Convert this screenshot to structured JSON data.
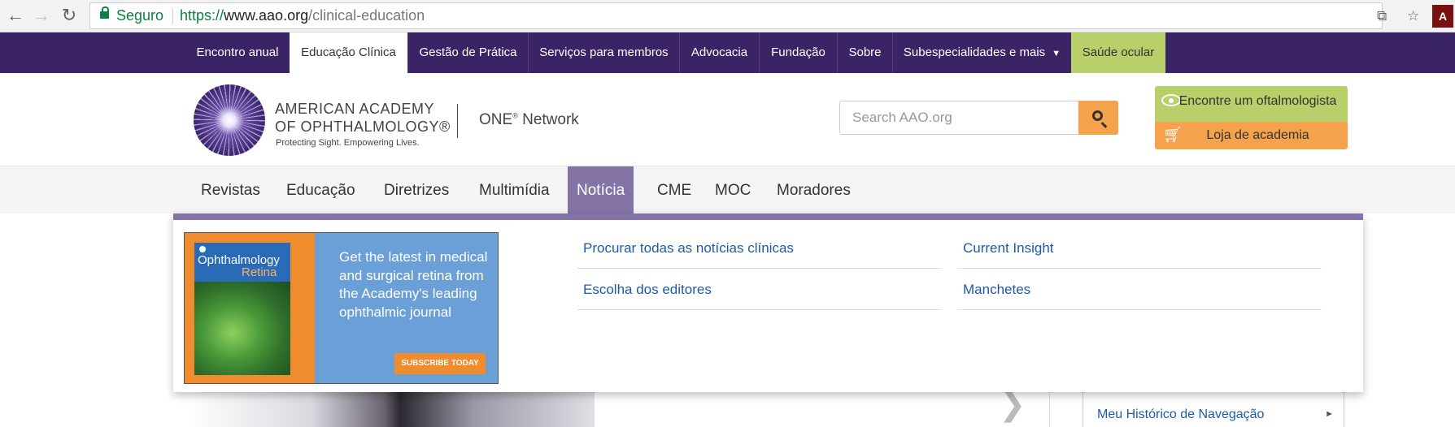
{
  "browser": {
    "secure_label": "Seguro",
    "url_scheme": "https://",
    "url_host": "www.aao.org",
    "url_path": "/clinical-education",
    "pdf_badge": "A"
  },
  "topbar": {
    "items": [
      "Encontro anual",
      "Educação Clínica",
      "Gestão de Prática",
      "Serviços para membros",
      "Advocacia",
      "Fundação",
      "Sobre",
      "Subespecialidades e mais",
      "Saúde ocular"
    ],
    "dropdown_arrow": "▼"
  },
  "logo": {
    "line1": "AMERICAN ACADEMY",
    "line2": "OF OPHTHALMOLOGY®",
    "tagline": "Protecting Sight. Empowering Lives.",
    "network_name": "ONE",
    "network_reg": "®",
    "network_suffix": " Network"
  },
  "search": {
    "placeholder": "Search AAO.org"
  },
  "cta": {
    "find": "Encontre um oftalmologista",
    "store": "Loja de academia"
  },
  "subnav": {
    "items": [
      "Revistas",
      "Educação",
      "Diretrizes",
      "Multimídia",
      "Notícia",
      "CME",
      "MOC",
      "Moradores"
    ]
  },
  "dropdown": {
    "ad": {
      "cover_title_1": "Ophthalmology",
      "cover_title_2": "Retina",
      "copy": "Get the latest in medical and surgical retina from the Academy's leading ophthalmic journal",
      "button": "SUBSCRIBE TODAY"
    },
    "links": [
      "Procurar todas as notícias clínicas",
      "Current Insight",
      "Escolha dos editores",
      "Manchetes"
    ]
  },
  "background": {
    "side_link": "Meu Histórico de Navegação",
    "side_arrow": "►",
    "next_arrow": "❯"
  },
  "colors": {
    "topbar": "#3a2466",
    "active_subnav": "#8474a6",
    "eye_health": "#b9cf6a",
    "accent_orange": "#f4a24b",
    "link": "#1e5aa8"
  }
}
